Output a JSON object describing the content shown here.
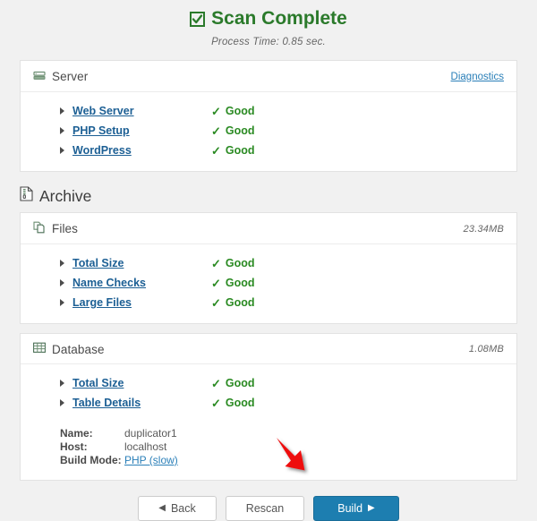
{
  "header": {
    "title": "Scan Complete",
    "check_icon": "checkbox-checked-icon",
    "process_time": "Process Time: 0.85 sec."
  },
  "colors": {
    "success_green": "#2a8a22",
    "title_green": "#2b7a2b",
    "link_blue": "#1c5f94",
    "accent_blue": "#1d7eb0",
    "page_bg": "#f1f1f1",
    "arrow_red": "#ee1111"
  },
  "server_panel": {
    "icon": "server-icon",
    "title": "Server",
    "diagnostics_label": "Diagnostics",
    "checks": [
      {
        "label": "Web Server",
        "status": "Good"
      },
      {
        "label": "PHP Setup",
        "status": "Good"
      },
      {
        "label": "WordPress",
        "status": "Good"
      }
    ]
  },
  "archive": {
    "icon": "archive-file-icon",
    "title": "Archive",
    "files_panel": {
      "icon": "files-icon",
      "title": "Files",
      "size": "23.34MB",
      "checks": [
        {
          "label": "Total Size",
          "status": "Good"
        },
        {
          "label": "Name Checks",
          "status": "Good"
        },
        {
          "label": "Large Files",
          "status": "Good"
        }
      ]
    },
    "database_panel": {
      "icon": "table-grid-icon",
      "title": "Database",
      "size": "1.08MB",
      "checks": [
        {
          "label": "Total Size",
          "status": "Good"
        },
        {
          "label": "Table Details",
          "status": "Good"
        }
      ],
      "info": [
        {
          "label": "Name:",
          "value": "duplicator1",
          "is_link": false
        },
        {
          "label": "Host:",
          "value": "localhost",
          "is_link": false
        },
        {
          "label": "Build Mode:",
          "value": "PHP (slow)",
          "is_link": true
        }
      ]
    }
  },
  "footer": {
    "back_label": "Back",
    "back_glyph": "◀",
    "rescan_label": "Rescan",
    "build_label": "Build",
    "build_glyph": "▶"
  },
  "annotation": {
    "arrow": "red-arrow-pointing-to-build-button"
  }
}
